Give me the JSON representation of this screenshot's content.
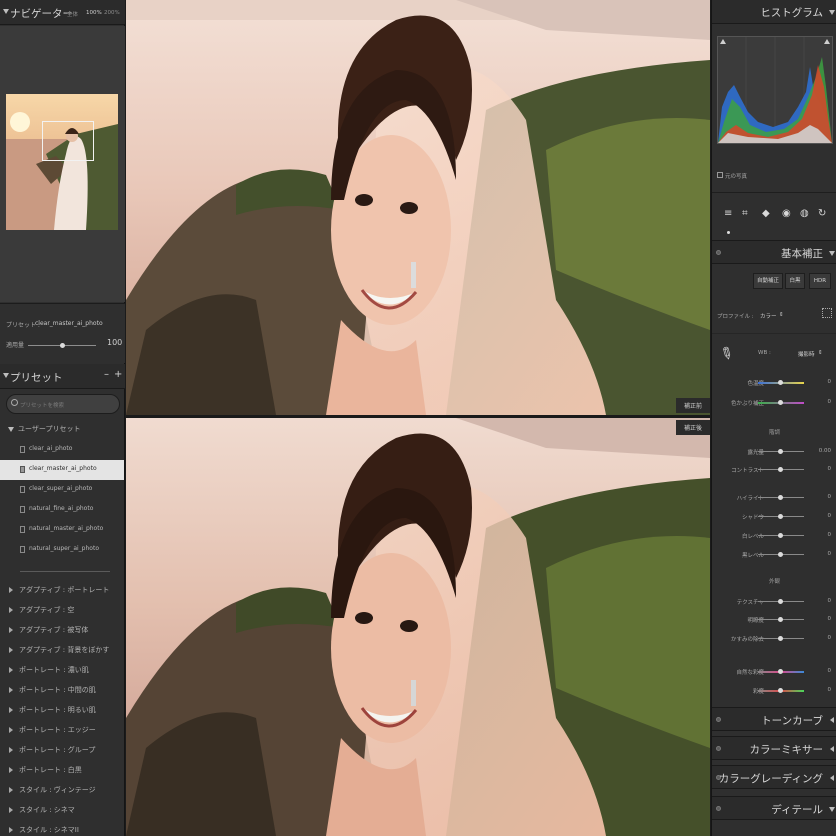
{
  "navigator": {
    "title": "ナビゲーター",
    "zoom_fit": "全体",
    "zoom_100": "100%",
    "zoom_200": "200%"
  },
  "preset_info": {
    "preset_label": "プリセット :",
    "preset_name": "clear_master_ai_photo",
    "amount_label": "適用量",
    "amount_value": "100",
    "amount_fraction": 1.0
  },
  "presets": {
    "title": "プリセット",
    "minus": "–",
    "plus": "+",
    "search_placeholder": "プリセットを検索",
    "user_group": "ユーザープリセット",
    "user_items": [
      {
        "label": "clear_ai_photo",
        "selected": false
      },
      {
        "label": "clear_master_ai_photo",
        "selected": true
      },
      {
        "label": "clear_super_ai_photo",
        "selected": false
      },
      {
        "label": "natural_fine_ai_photo",
        "selected": false
      },
      {
        "label": "natural_master_ai_photo",
        "selected": false
      },
      {
        "label": "natural_super_ai_photo",
        "selected": false
      }
    ],
    "groups": [
      "アダプティブ : ポートレート",
      "アダプティブ : 空",
      "アダプティブ : 被写体",
      "アダプティブ : 背景をぼかす",
      "ポートレート : 濃い肌",
      "ポートレート : 中間の肌",
      "ポートレート : 明るい肌",
      "ポートレート : エッジー",
      "ポートレート : グループ",
      "ポートレート : 白黒",
      "スタイル : ヴィンテージ",
      "スタイル : シネマ",
      "スタイル : シネマII"
    ]
  },
  "view": {
    "before_label": "補正前",
    "after_label": "補正後"
  },
  "histogram": {
    "title": "ヒストグラム",
    "original_photo": "元の写真"
  },
  "basic": {
    "title": "基本補正",
    "auto": "自動補正",
    "bw": "白黒",
    "hdr": "HDR",
    "profile_label": "プロファイル :",
    "profile_value": "カラー",
    "wb_label": "WB :",
    "wb_value": "撮影時",
    "color_temp": {
      "label": "色温度",
      "value": "0"
    },
    "tint": {
      "label": "色かぶり補正",
      "value": "0"
    },
    "tone_section": "階調",
    "exposure": {
      "label": "露光量",
      "value": "0.00"
    },
    "contrast": {
      "label": "コントラスト",
      "value": "0"
    },
    "highlights": {
      "label": "ハイライト",
      "value": "0"
    },
    "shadows": {
      "label": "シャドウ",
      "value": "0"
    },
    "whites": {
      "label": "白レベル",
      "value": "0"
    },
    "blacks": {
      "label": "黒レベル",
      "value": "0"
    },
    "presence_section": "外観",
    "texture": {
      "label": "テクスチャ",
      "value": "0"
    },
    "clarity": {
      "label": "明瞭度",
      "value": "0"
    },
    "dehaze": {
      "label": "かすみの除去",
      "value": "0"
    },
    "vibrance": {
      "label": "自然な彩度",
      "value": "0"
    },
    "saturation": {
      "label": "彩度",
      "value": "0"
    }
  },
  "panels": {
    "tone_curve": "トーンカーブ",
    "color_mixer": "カラーミキサー",
    "color_grading": "カラーグレーディング",
    "detail": "ディテール"
  },
  "colors": {
    "panel_bg": "#2f2f2f",
    "header_bg": "#2b2b2b",
    "selected_row": "#e4e4e4",
    "hist_blue": "#2f6fd0",
    "hist_green": "#3da142",
    "hist_red": "#d8452a"
  }
}
